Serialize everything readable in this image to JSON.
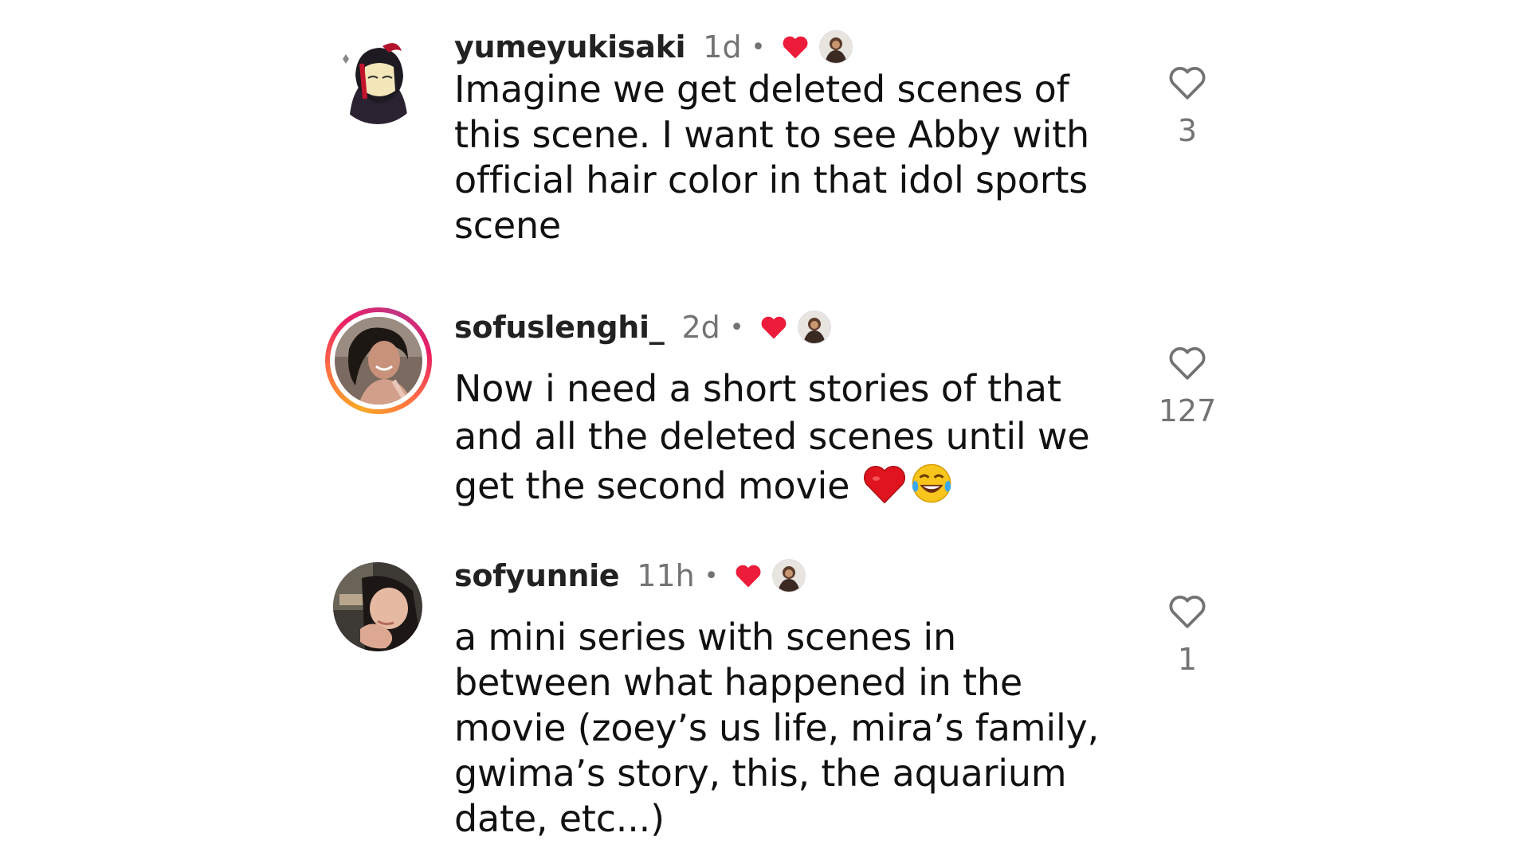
{
  "comments": [
    {
      "username": "yumeyukisaki",
      "time": "1d",
      "separator": "•",
      "avatar_icon": "anime-girl-avatar",
      "text_lines": [
        "Imagine we get deleted scenes of",
        "this scene. I want to see Abby with",
        "official hair color in that idol sports",
        "scene"
      ],
      "like_count": "3",
      "has_story_ring": false
    },
    {
      "username": "sofuslenghi_",
      "time": "2d",
      "separator": "•",
      "avatar_icon": "profile-photo-avatar",
      "text_lines": [
        "Now i need a short stories of that",
        "and all the deleted scenes until we",
        "get the second movie"
      ],
      "trailing_emoji": [
        "red-heart-emoji",
        "tears-of-joy-emoji"
      ],
      "like_count": "127",
      "has_story_ring": true
    },
    {
      "username": "sofyunnie",
      "time": "11h",
      "separator": "•",
      "avatar_icon": "profile-photo-avatar",
      "text_lines": [
        "a mini series with scenes in",
        "between what happened in the",
        "movie (zoey’s us life, mira’s family,",
        "gwima’s story, this, the aquarium",
        "date, etc...)"
      ],
      "like_count": "1",
      "has_story_ring": false
    }
  ],
  "colors": {
    "creator_heart": "#ed1c3a",
    "muted_text": "#737373",
    "story_ring_start": "#f9a825",
    "story_ring_end": "#c13584"
  }
}
